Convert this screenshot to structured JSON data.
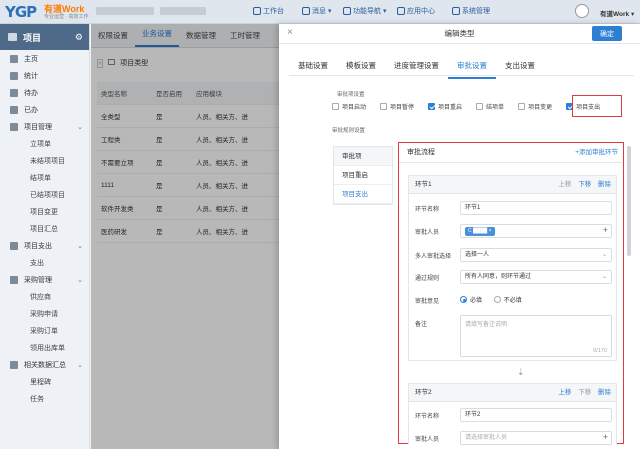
{
  "header": {
    "logo_text": "YGP",
    "logo_sub": "有道Work",
    "logo_tag": "专业运营 · 高效工作",
    "nav": [
      {
        "label": "工作台",
        "icon": "desktop-icon"
      },
      {
        "label": "消息",
        "icon": "message-icon"
      },
      {
        "label": "功能导航",
        "icon": "compass-icon"
      },
      {
        "label": "应用中心",
        "icon": "apps-icon"
      },
      {
        "label": "系统管理",
        "icon": "gear-icon"
      }
    ],
    "user": "有道Work"
  },
  "sidebar": {
    "title": "项目",
    "items": [
      {
        "label": "主页",
        "level": 1
      },
      {
        "label": "统计",
        "level": 1
      },
      {
        "label": "待办",
        "level": 1
      },
      {
        "label": "已办",
        "level": 1
      },
      {
        "label": "项目管理",
        "level": 1,
        "expandable": true
      },
      {
        "label": "立项单",
        "level": 2
      },
      {
        "label": "未结项项目",
        "level": 2
      },
      {
        "label": "结项单",
        "level": 2
      },
      {
        "label": "已结项项目",
        "level": 2
      },
      {
        "label": "项目变更",
        "level": 2
      },
      {
        "label": "项目汇总",
        "level": 2
      },
      {
        "label": "项目支出",
        "level": 1,
        "expandable": true
      },
      {
        "label": "支出",
        "level": 2
      },
      {
        "label": "采购管理",
        "level": 1,
        "expandable": true
      },
      {
        "label": "供应商",
        "level": 2
      },
      {
        "label": "采购申请",
        "level": 2
      },
      {
        "label": "采购订单",
        "level": 2
      },
      {
        "label": "领用出库单",
        "level": 2
      },
      {
        "label": "相关数据汇总",
        "level": 1,
        "expandable": true
      },
      {
        "label": "里程碑",
        "level": 2
      },
      {
        "label": "任务",
        "level": 2
      }
    ]
  },
  "tabs": [
    "权限设置",
    "业务设置",
    "数据管理",
    "工时管理"
  ],
  "active_tab": 1,
  "content": {
    "breadcrumb": "项目类型",
    "columns": [
      "类型名称",
      "是否启用",
      "应用模块"
    ],
    "rows": [
      [
        "全类型",
        "是",
        "人员、相关方、进"
      ],
      [
        "工程类",
        "是",
        "人员、相关方、进"
      ],
      [
        "不需要立项",
        "是",
        "人员、相关方、进"
      ],
      [
        "1111",
        "是",
        "人员、相关方、进"
      ],
      [
        "软件开发类",
        "是",
        "人员、相关方、进"
      ],
      [
        "医药研发",
        "是",
        "人员、相关方、进"
      ]
    ]
  },
  "panel": {
    "title": "编辑类型",
    "confirm": "确定",
    "tabs": [
      "基础设置",
      "模板设置",
      "进度管理设置",
      "审批设置",
      "支出设置"
    ],
    "active_tab": 3,
    "approval_section_label": "审批项设置",
    "checkboxes": [
      {
        "label": "项目启动",
        "checked": false
      },
      {
        "label": "项目暂停",
        "checked": false
      },
      {
        "label": "项目重启",
        "checked": true
      },
      {
        "label": "结项单",
        "checked": false
      },
      {
        "label": "项目变更",
        "checked": false
      },
      {
        "label": "项目支出",
        "checked": true
      }
    ],
    "rule_section_label": "审批规则设置",
    "left_list": {
      "header": "审批项",
      "items": [
        "项目重启",
        "项目支出"
      ],
      "active": 1
    },
    "flow": {
      "title": "审批流程",
      "add_node": "+添加审批环节",
      "nodes": [
        {
          "title": "环节1",
          "ops": {
            "up": "上移",
            "down": "下移",
            "del": "删除"
          },
          "name_label": "环节名称",
          "name_value": "环节1",
          "approver_label": "审批人员",
          "approver_chip": "C",
          "multi_label": "多人审批选择",
          "multi_value": "选择一人",
          "rule_label": "通过规则",
          "rule_value": "所有人同意，则环节通过",
          "opinion_label": "审批意见",
          "opinion_required": "必填",
          "opinion_optional": "不必填",
          "remark_label": "备注",
          "remark_placeholder": "请填写备注说明",
          "remark_counter": "0/170"
        },
        {
          "title": "环节2",
          "ops": {
            "up": "上移",
            "down": "下移",
            "del": "删除"
          },
          "name_label": "环节名称",
          "name_value": "环节2",
          "approver_label": "审批人员",
          "approver_placeholder": "请选择审批人员"
        }
      ]
    }
  }
}
